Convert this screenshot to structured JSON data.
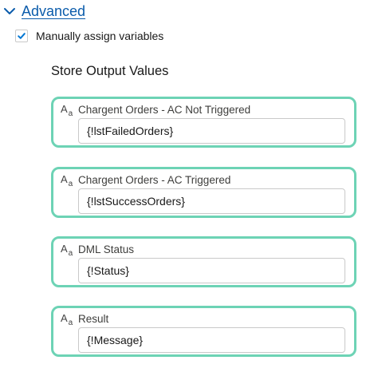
{
  "advanced": {
    "label": "Advanced",
    "expanded": true,
    "chevron_icon": "chevron-down-icon"
  },
  "manual_assign": {
    "label": "Manually assign variables",
    "checked": true
  },
  "section": {
    "title": "Store Output Values"
  },
  "outputs": [
    {
      "label": "Chargent Orders - AC Not Triggered",
      "value": "{!lstFailedOrders}"
    },
    {
      "label": "Chargent Orders - AC Triggered",
      "value": "{!lstSuccessOrders}"
    },
    {
      "label": "DML Status",
      "value": "{!Status}"
    },
    {
      "label": "Result",
      "value": "{!Message}"
    }
  ],
  "colors": {
    "link": "#0b5cab",
    "highlight_border": "#6dd3b5",
    "checkbox_check": "#0176d3"
  }
}
